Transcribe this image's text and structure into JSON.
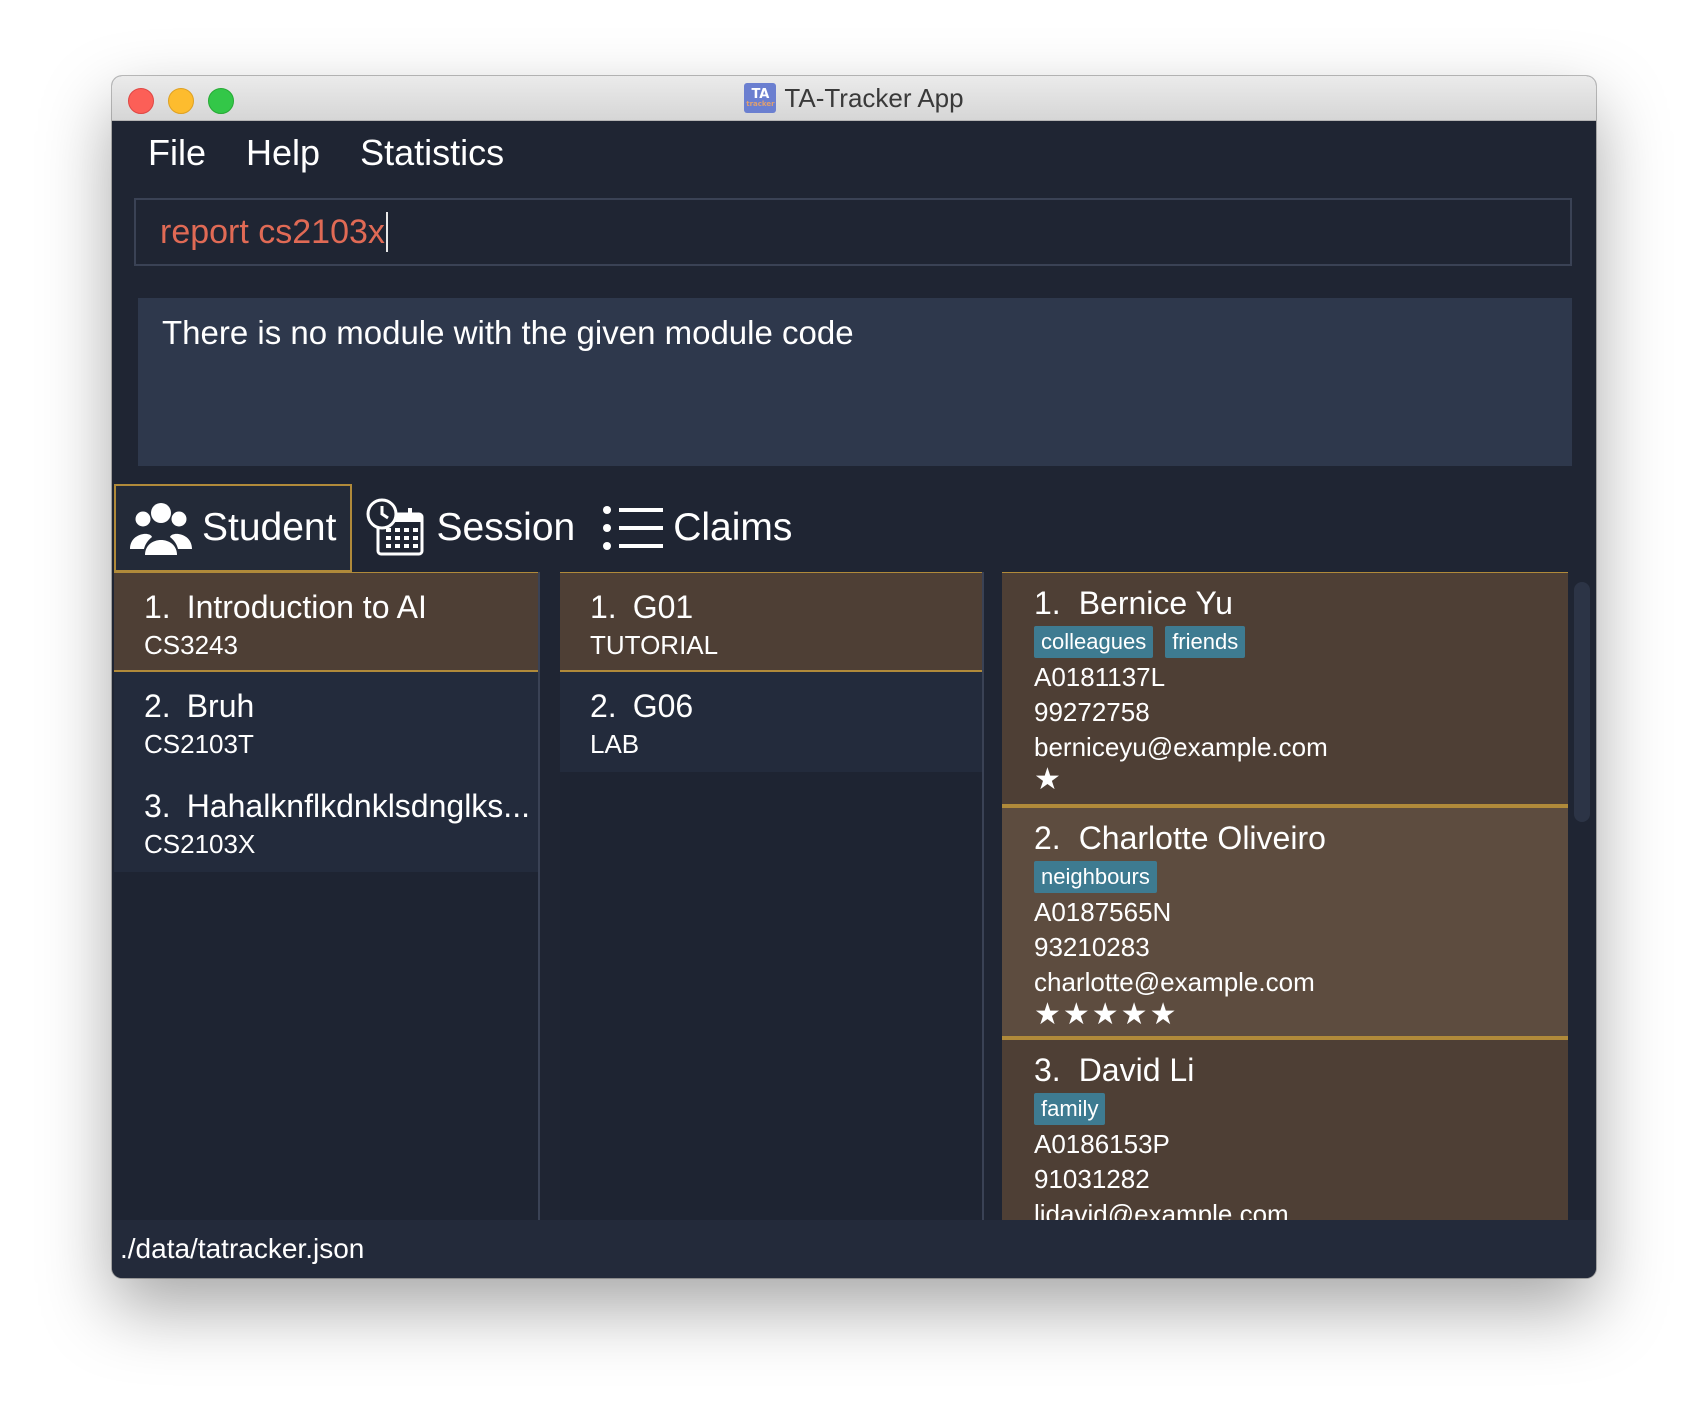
{
  "window": {
    "title": "TA-Tracker App",
    "icon_text": "TA",
    "icon_subtext": "tracker"
  },
  "menu": [
    "File",
    "Help",
    "Statistics"
  ],
  "command": {
    "value": "report cs2103x"
  },
  "result": {
    "text": "There is no module with the given module code"
  },
  "tabs": [
    {
      "label": "Student",
      "icon": "students-icon",
      "active": true
    },
    {
      "label": "Session",
      "icon": "calendar-clock-icon",
      "active": false
    },
    {
      "label": "Claims",
      "icon": "list-icon",
      "active": false
    }
  ],
  "modules": [
    {
      "index": "1.",
      "name": "Introduction to AI",
      "code": "CS3243"
    },
    {
      "index": "2.",
      "name": "Bruh",
      "code": "CS2103T"
    },
    {
      "index": "3.",
      "name": "Hahalknflkdnklsdnglks...",
      "code": "CS2103X"
    }
  ],
  "sessions": [
    {
      "index": "1.",
      "name": "G01",
      "type": "TUTORIAL"
    },
    {
      "index": "2.",
      "name": "G06",
      "type": "LAB"
    }
  ],
  "students": [
    {
      "index": "1.",
      "name": "Bernice Yu",
      "tags": [
        "colleagues",
        "friends"
      ],
      "matric": "A0181137L",
      "phone": "99272758",
      "email": "berniceyu@example.com",
      "rating": "★"
    },
    {
      "index": "2.",
      "name": "Charlotte Oliveiro",
      "tags": [
        "neighbours"
      ],
      "matric": "A0187565N",
      "phone": "93210283",
      "email": "charlotte@example.com",
      "rating": "★★★★★"
    },
    {
      "index": "3.",
      "name": "David Li",
      "tags": [
        "family"
      ],
      "matric": "A0186153P",
      "phone": "91031282",
      "email": "lidavid@example.com",
      "rating": ""
    }
  ],
  "status": {
    "path": "./data/tatracker.json"
  },
  "colors": {
    "background": "#1f2533",
    "selected_card": "#4e3f35",
    "accent_border": "#b08a3a",
    "tag": "#3e7b91",
    "command_text": "#e06a55"
  }
}
